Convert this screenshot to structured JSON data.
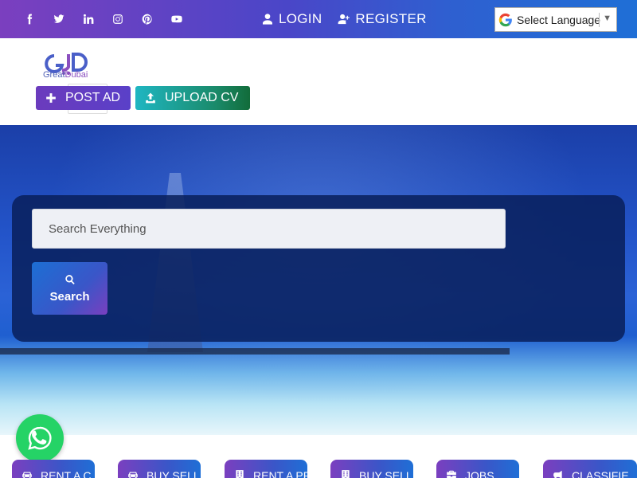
{
  "topbar": {
    "social": [
      {
        "icon": "facebook-icon"
      },
      {
        "icon": "twitter-icon"
      },
      {
        "icon": "linkedin-icon"
      },
      {
        "icon": "instagram-icon"
      },
      {
        "icon": "pinterest-icon"
      },
      {
        "icon": "youtube-icon"
      }
    ],
    "login_label": "LOGIN",
    "register_label": "REGISTER",
    "language_label": "Select Language"
  },
  "header": {
    "logo_text_a": "Great",
    "logo_text_b": "Dubai",
    "post_ad_label": "POST AD",
    "upload_cv_label": "UPLOAD CV"
  },
  "search": {
    "placeholder": "Search Everything",
    "button_label": "Search"
  },
  "categories": [
    {
      "label": "RENT A C",
      "icon": "car-icon"
    },
    {
      "label": "BUY SELL",
      "icon": "car-icon"
    },
    {
      "label": "RENT A PR",
      "icon": "building-icon"
    },
    {
      "label": "BUY SELL",
      "icon": "building-icon"
    },
    {
      "label": "JOBS",
      "icon": "briefcase-icon"
    },
    {
      "label": "CLASSIFIE",
      "icon": "megaphone-icon"
    }
  ],
  "colors": {
    "brand_purple": "#7b3fbf",
    "brand_blue": "#1f6fd6",
    "teal": "#1fb6c2",
    "whatsapp_green": "#25d366"
  }
}
